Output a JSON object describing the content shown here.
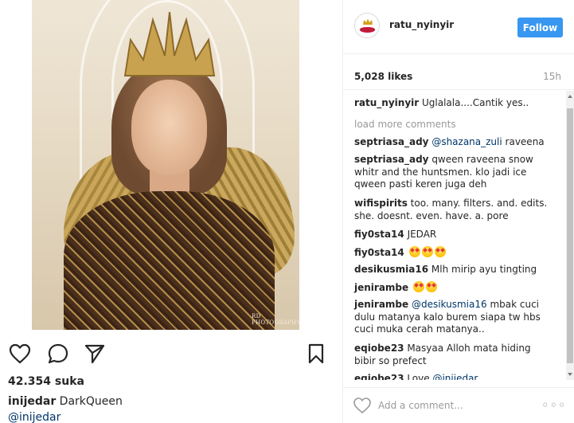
{
  "post": {
    "photo_alt": "",
    "watermark": "RD PHOTOGRAPHY",
    "actions": {
      "like_icon": "heart-outline-icon",
      "comment_icon": "comment-bubble-icon",
      "share_icon": "paper-plane-icon",
      "save_icon": "bookmark-icon"
    },
    "likes_left": "42.354 suka",
    "caption_user": "inijedar",
    "caption_text": " DarkQueen",
    "mention": "@inijedar"
  },
  "header": {
    "username": "ratu_nyinyir",
    "follow_label": "Follow",
    "avatar_icon": "crown-lips-logo"
  },
  "likes_bar": {
    "count": "5,028 likes",
    "time": "15h"
  },
  "comments": {
    "load_more": "load more comments",
    "items": [
      {
        "user": "ratu_nyinyir",
        "text": " Uglalala....Cantik yes.."
      },
      {
        "user": "septriasa_ady",
        "mention": " @shazana_zuli",
        "text": " raveena"
      },
      {
        "user": "septriasa_ady",
        "text": " qween raveena snow whitr and the huntsmen. klo jadi ice qween pasti keren juga deh"
      },
      {
        "user": "wifispirits",
        "text": " too. many. filters. and. edits. she. doesnt. even. have. a. pore"
      },
      {
        "user": "fiy0sta14",
        "text": " JEDAR"
      },
      {
        "user": "fiy0sta14",
        "text": " "
      },
      {
        "user": "desikusmia16",
        "text": " Mlh mirip ayu tingting"
      },
      {
        "user": "jenirambe",
        "text": " "
      },
      {
        "user": "jenirambe",
        "mention": " @desikusmia16",
        "text": " mbak cuci dulu matanya kalo burem siapa tw hbs cuci muka cerah matanya.."
      },
      {
        "user": "eqiobe23",
        "text": " Masyaa Alloh mata hiding bibir so prefect"
      },
      {
        "user": "eqiobe23",
        "text": " Love",
        "mention": " @inijedar"
      }
    ]
  },
  "add_comment": {
    "placeholder": "Add a comment...",
    "more_label": "◦◦◦"
  },
  "colors": {
    "follow_blue": "#3897f0",
    "mention_blue": "#003569",
    "muted_gray": "#999999",
    "text": "#262626"
  }
}
